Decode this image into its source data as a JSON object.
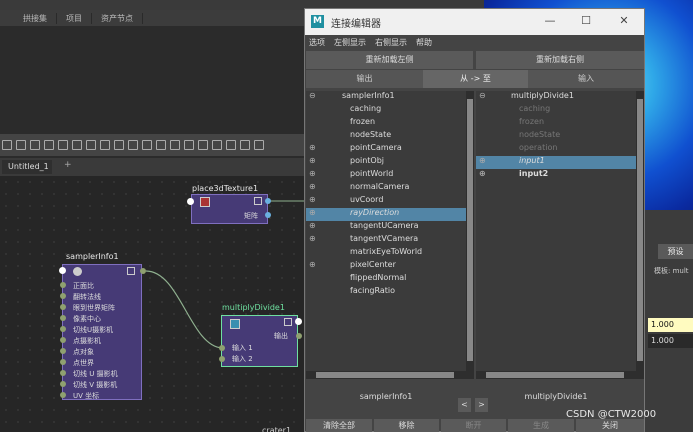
{
  "maya": {
    "panel_tabs": [
      "拱接集",
      "项目",
      "资产节点"
    ],
    "scene_tab": "Untitled_1",
    "scene_tab_add": "+",
    "preset_label": "预设",
    "template_label": "模板: mult",
    "value_1": "1.000",
    "value_2": "1.000",
    "crater_label": "crater1"
  },
  "nodes": {
    "place3d": {
      "title": "place3dTexture1",
      "attrs": [
        "矩阵"
      ]
    },
    "sampler": {
      "title": "samplerInfo1",
      "attrs": [
        "正面比",
        "翻转法线",
        "眼到世界矩阵",
        "像素中心",
        "切线U摄影机",
        "点摄影机",
        "点对象",
        "点世界",
        "切线 U 摄影机",
        "切线 V 摄影机",
        "UV 坐标"
      ]
    },
    "multiply": {
      "title": "multiplyDivide1",
      "output_label": "输出",
      "attrs": [
        "输入 1",
        "输入 2"
      ]
    }
  },
  "dialog": {
    "title": "连接编辑器",
    "window_buttons": [
      "—",
      "☐",
      "✕"
    ],
    "menu": [
      "选项",
      "左侧显示",
      "右侧显示",
      "帮助"
    ],
    "reload_left": "重新加载左侧",
    "reload_right": "重新加载右侧",
    "output_tab": "输出",
    "mode_label": "从 -> 至",
    "input_tab": "输入",
    "left_list": {
      "root": "samplerInfo1",
      "items": [
        {
          "label": "caching",
          "expand": ""
        },
        {
          "label": "frozen",
          "expand": ""
        },
        {
          "label": "nodeState",
          "expand": ""
        },
        {
          "label": "pointCamera",
          "expand": "⊕"
        },
        {
          "label": "pointObj",
          "expand": "⊕"
        },
        {
          "label": "pointWorld",
          "expand": "⊕"
        },
        {
          "label": "normalCamera",
          "expand": "⊕"
        },
        {
          "label": "uvCoord",
          "expand": "⊕"
        },
        {
          "label": "rayDirection",
          "expand": "⊕"
        },
        {
          "label": "tangentUCamera",
          "expand": "⊕"
        },
        {
          "label": "tangentVCamera",
          "expand": "⊕"
        },
        {
          "label": "matrixEyeToWorld",
          "expand": ""
        },
        {
          "label": "pixelCenter",
          "expand": "⊕"
        },
        {
          "label": "flippedNormal",
          "expand": ""
        },
        {
          "label": "facingRatio",
          "expand": ""
        }
      ],
      "root_expand": "⊖"
    },
    "right_list": {
      "root": "multiplyDivide1",
      "root_expand": "⊖",
      "items": [
        {
          "label": "caching",
          "expand": ""
        },
        {
          "label": "frozen",
          "expand": ""
        },
        {
          "label": "nodeState",
          "expand": ""
        },
        {
          "label": "operation",
          "expand": ""
        },
        {
          "label": "input1",
          "expand": "⊕"
        },
        {
          "label": "input2",
          "expand": "⊕"
        }
      ]
    },
    "footer_left": "samplerInfo1",
    "footer_right": "multiplyDivide1",
    "nav_left": "<",
    "nav_right": ">",
    "buttons": [
      "清除全部",
      "移除",
      "断开",
      "生成",
      "关闭"
    ]
  },
  "watermark": "CSDN @CTW2000"
}
